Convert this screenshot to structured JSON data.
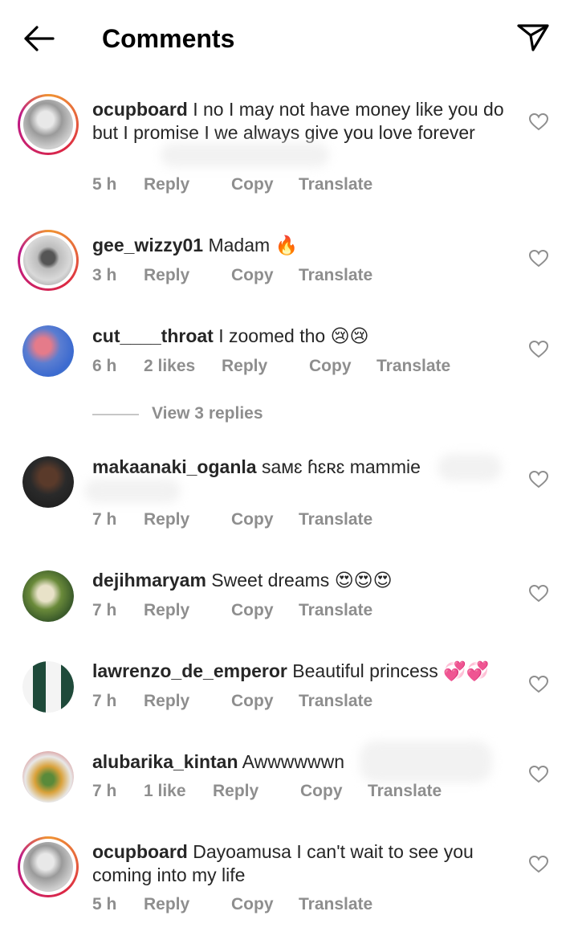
{
  "header": {
    "title": "Comments"
  },
  "comments": [
    {
      "username": "ocupboard",
      "text": "I no I may not have money like you do but I promise I we always give you love forever",
      "time": "5 h",
      "likes": "",
      "reply": "Reply",
      "copy": "Copy",
      "translate": "Translate"
    },
    {
      "username": "gee_wizzy01",
      "text": "Madam 🔥",
      "time": "3 h",
      "likes": "",
      "reply": "Reply",
      "copy": "Copy",
      "translate": "Translate"
    },
    {
      "username": "cut____throat",
      "text": "I zoomed tho 😢😢",
      "time": "6 h",
      "likes": "2 likes",
      "reply": "Reply",
      "copy": "Copy",
      "translate": "Translate"
    },
    {
      "username": "makaanaki_oganla",
      "text": "saᴍɛ ɦɛʀɛ mammie",
      "time": "7 h",
      "likes": "",
      "reply": "Reply",
      "copy": "Copy",
      "translate": "Translate"
    },
    {
      "username": "dejihmaryam",
      "text": "Sweet dreams 😍😍😍",
      "time": "7 h",
      "likes": "",
      "reply": "Reply",
      "copy": "Copy",
      "translate": "Translate"
    },
    {
      "username": "lawrenzo_de_emperor",
      "text": "Beautiful princess 💞💞",
      "time": "7 h",
      "likes": "",
      "reply": "Reply",
      "copy": "Copy",
      "translate": "Translate"
    },
    {
      "username": "alubarika_kintan",
      "text": "Awwwwwwn",
      "time": "7 h",
      "likes": "1 like",
      "reply": "Reply",
      "copy": "Copy",
      "translate": "Translate"
    },
    {
      "username": "ocupboard",
      "text": "Dayoamusa I can't wait to see you coming into my life",
      "time": "5 h",
      "likes": "",
      "reply": "Reply",
      "copy": "Copy",
      "translate": "Translate"
    }
  ],
  "view_replies": "View 3 replies",
  "icons": {
    "back": "arrow-left-icon",
    "share": "paper-plane-icon",
    "like": "heart-outline-icon"
  },
  "colors": {
    "meta_text": "#8e8e8e",
    "body_text": "#262626",
    "story_ring": [
      "#f09433",
      "#dc2743",
      "#bc1888"
    ]
  }
}
